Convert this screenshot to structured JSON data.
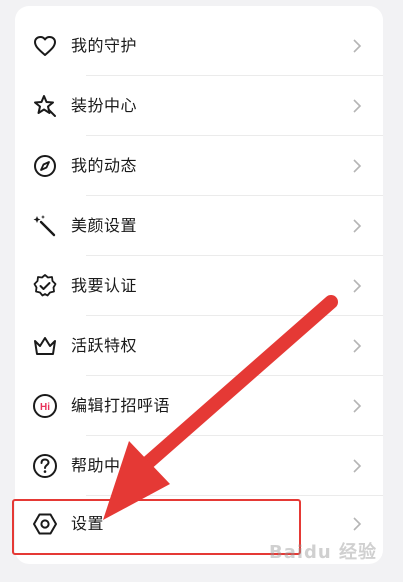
{
  "menu": {
    "items": [
      {
        "label": "我的守护",
        "icon": "heart-icon"
      },
      {
        "label": "装扮中心",
        "icon": "magic-star-icon"
      },
      {
        "label": "我的动态",
        "icon": "compass-icon"
      },
      {
        "label": "美颜设置",
        "icon": "magic-wand-icon"
      },
      {
        "label": "我要认证",
        "icon": "verified-badge-icon"
      },
      {
        "label": "活跃特权",
        "icon": "crown-icon"
      },
      {
        "label": "编辑打招呼语",
        "icon": "hi-bubble-icon",
        "badge": "Hi"
      },
      {
        "label": "帮助中心",
        "icon": "help-circle-icon"
      },
      {
        "label": "设置",
        "icon": "hexagon-settings-icon"
      }
    ]
  },
  "watermark": "Baidu 经验",
  "colors": {
    "annotation": "#e53935",
    "hi_badge": "#e8335a"
  }
}
